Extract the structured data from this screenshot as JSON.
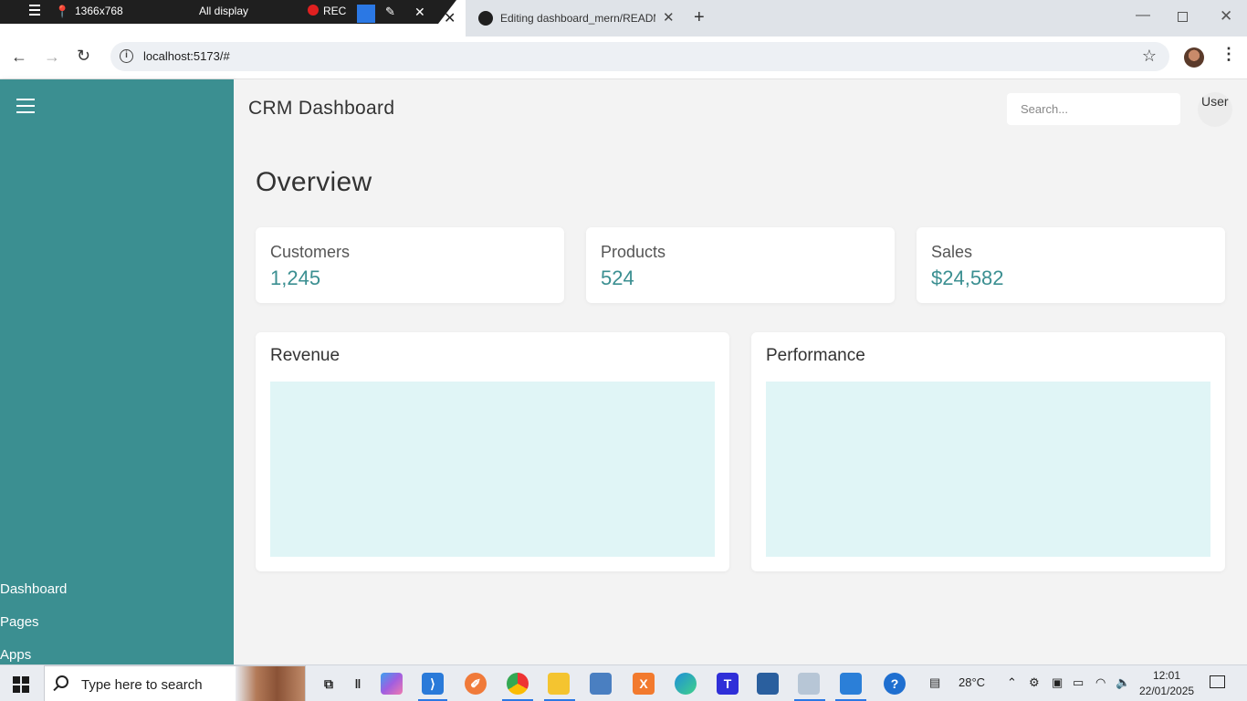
{
  "recorder": {
    "resolution": "1366x768",
    "display": "All display",
    "rec_label": "REC"
  },
  "browser": {
    "active_tab_close": "✕",
    "tabs": [
      {
        "title": "Editing dashboard_mern/READM"
      }
    ],
    "new_tab": "+",
    "url": "localhost:5173/#"
  },
  "app": {
    "title": "CRM Dashboard",
    "search_placeholder": "Search...",
    "user_avatar_alt": "User",
    "sidebar": {
      "items": [
        {
          "label": "Dashboard"
        },
        {
          "label": "Pages"
        },
        {
          "label": "Apps"
        }
      ]
    },
    "page_heading": "Overview",
    "stats": [
      {
        "label": "Customers",
        "value": "1,245"
      },
      {
        "label": "Products",
        "value": "524"
      },
      {
        "label": "Sales",
        "value": "$24,582"
      }
    ],
    "charts": [
      {
        "title": "Revenue"
      },
      {
        "title": "Performance"
      }
    ],
    "colors": {
      "sidebar": "#3b8f91",
      "accent": "#3b8f91",
      "chart_placeholder": "#e0f5f6"
    }
  },
  "taskbar": {
    "search_text": "Type here to search",
    "weather": "28°C",
    "time": "12:01",
    "date": "22/01/2025"
  }
}
